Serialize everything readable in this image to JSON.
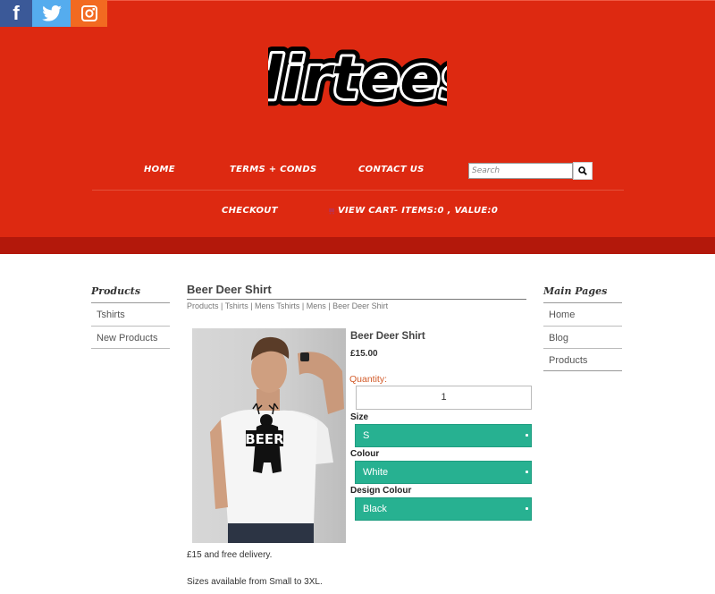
{
  "social": {
    "facebook": "f",
    "twitter": "twitter-bird",
    "instagram": "instagram-camera"
  },
  "brand": {
    "logo_text": "dirtees"
  },
  "nav": {
    "home": "Home",
    "terms": "Terms + Conds",
    "contact": "Contact Us",
    "checkout": "Checkout",
    "view_cart": "View Cart",
    "cart_summary": "-  Items:0 , Value:0"
  },
  "search": {
    "placeholder": "Search"
  },
  "left_sidebar": {
    "title": "Products",
    "items": [
      "Tshirts",
      "New Products"
    ]
  },
  "right_sidebar": {
    "title": "Main Pages",
    "items": [
      "Home",
      "Blog",
      "Products"
    ]
  },
  "product": {
    "page_title": "Beer Deer Shirt",
    "breadcrumb": "Products  |  Tshirts  |  Mens Tshirts  |  Mens  |   Beer Deer Shirt",
    "name": "Beer Deer Shirt",
    "price": "£15.00",
    "image_text": "BEER",
    "quantity_label": "Quantity:",
    "quantity_value": "1",
    "options": [
      {
        "label": "Size",
        "value": "S"
      },
      {
        "label": "Colour",
        "value": "White"
      },
      {
        "label": "Design Colour",
        "value": "Black"
      }
    ],
    "description": [
      "£15 and free delivery.",
      "Sizes available from Small to 3XL."
    ]
  },
  "colors": {
    "header_red": "#dd2911",
    "accent_green": "#27b191"
  }
}
